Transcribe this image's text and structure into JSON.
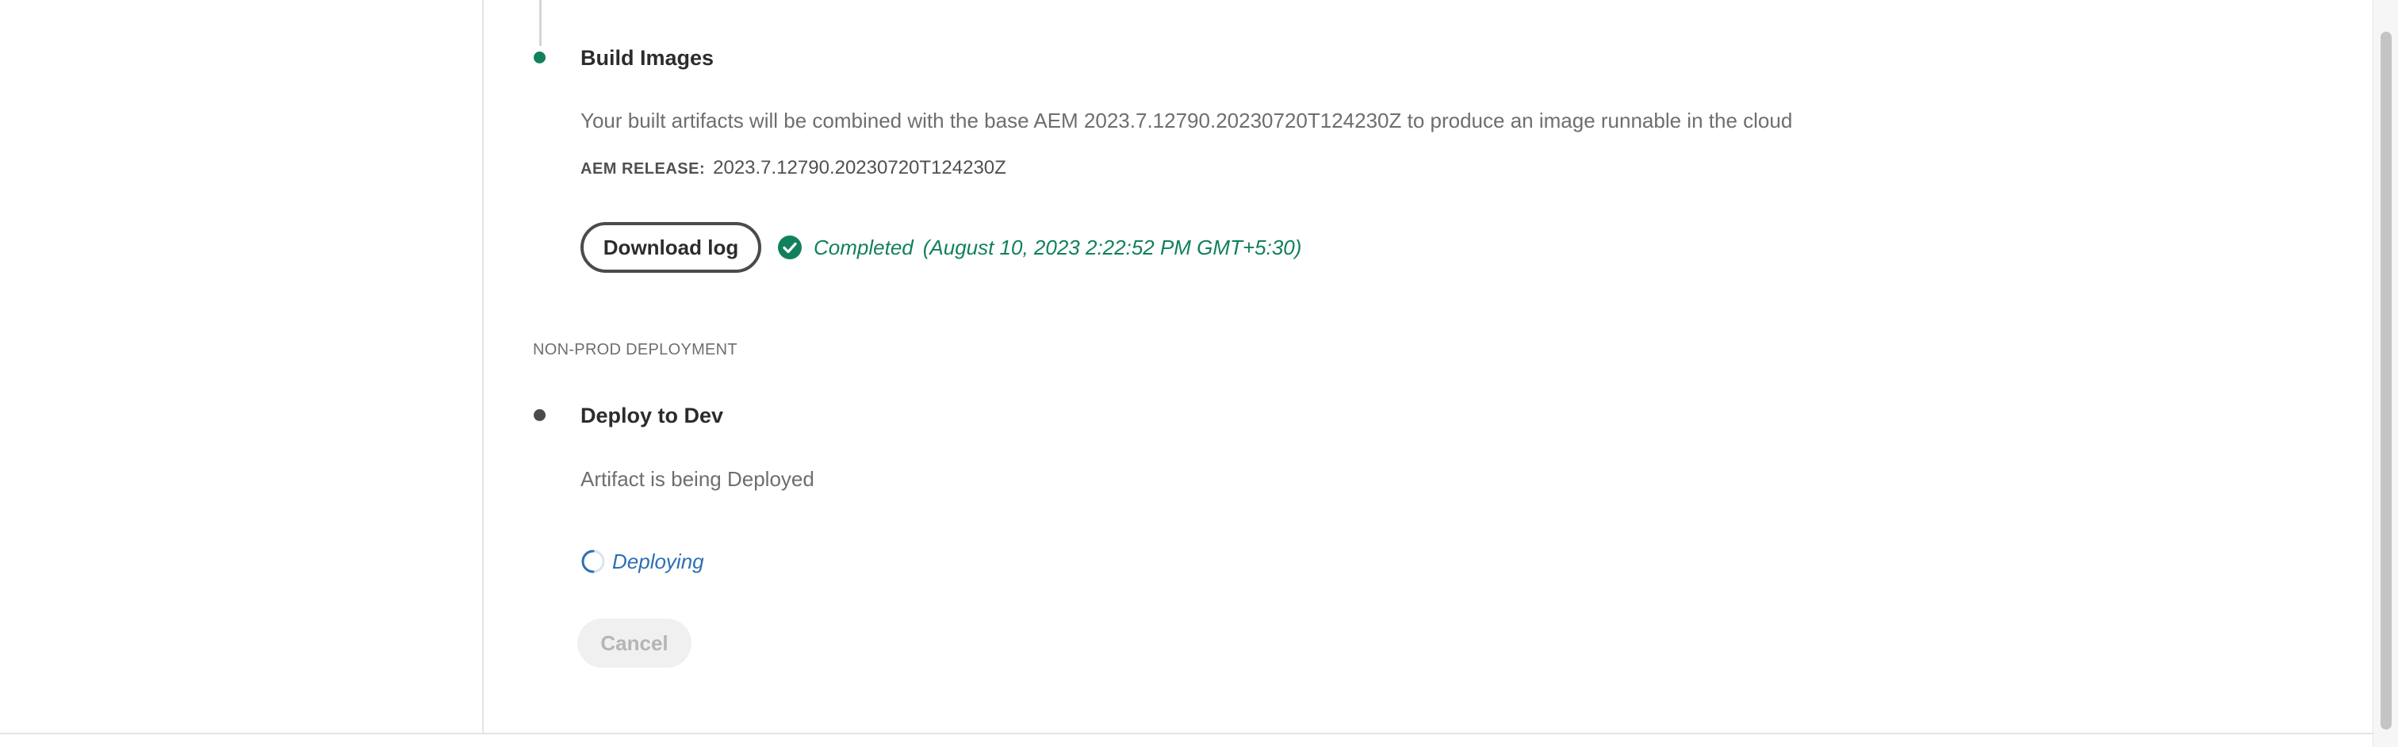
{
  "build_step": {
    "title": "Build Images",
    "description": "Your built artifacts will be combined with the base AEM 2023.7.12790.20230720T124230Z to produce an image runnable in the cloud",
    "release_label": "AEM RELEASE:",
    "release_value": "2023.7.12790.20230720T124230Z",
    "download_label": "Download log",
    "status_text": "Completed",
    "status_time": "(August 10, 2023 2:22:52 PM GMT+5:30)",
    "status_color": "#12805c"
  },
  "section_label": "NON-PROD DEPLOYMENT",
  "deploy_step": {
    "title": "Deploy to Dev",
    "description": "Artifact is being Deployed",
    "status_text": "Deploying",
    "status_color": "#2d6fb5",
    "cancel_label": "Cancel"
  },
  "icons": {
    "completed": "check-circle-icon",
    "deploying": "spinner-icon"
  }
}
